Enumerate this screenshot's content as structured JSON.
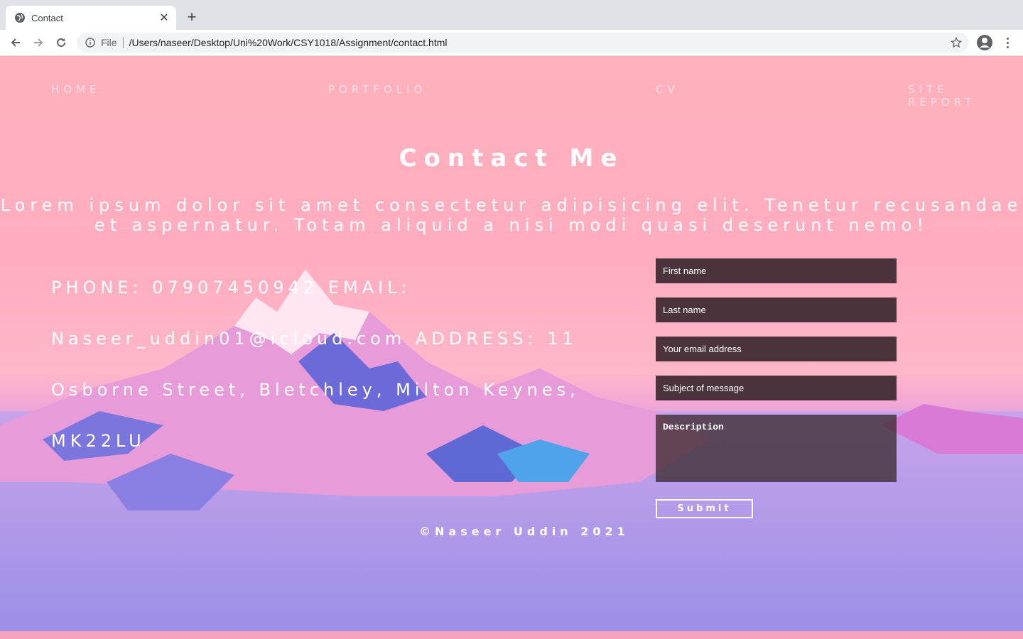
{
  "browser": {
    "tab_title": "Contact",
    "new_tab": "+",
    "close": "✕",
    "file_label": "File",
    "url": "/Users/naseer/Desktop/Uni%20Work/CSY1018/Assignment/contact.html"
  },
  "nav": {
    "home": "HOME",
    "portfolio": "PORTFOLIO",
    "cv": "CV",
    "site_report": "SITE REPORT"
  },
  "page": {
    "title": "Contact Me",
    "intro": "Lorem ipsum dolor sit amet consectetur adipisicing elit. Tenetur recusandae et aspernatur. Totam aliquid a nisi modi quasi deserunt nemo!",
    "contact_info": "PHONE: 07907450942 EMAIL: Naseer_uddin01@icloud.com ADDRESS: 11 Osborne Street, Bletchley, Milton Keynes, MK22LU"
  },
  "form": {
    "first_name": "First name",
    "last_name": "Last name",
    "email": "Your email address",
    "subject": "Subject of message",
    "description": "Description",
    "submit": "Submit"
  },
  "footer": {
    "text": "©Naseer Uddin 2021"
  },
  "colors": {
    "accent": "#ffb1bc",
    "field_bg": "#3c2830",
    "text": "#ffffff"
  }
}
